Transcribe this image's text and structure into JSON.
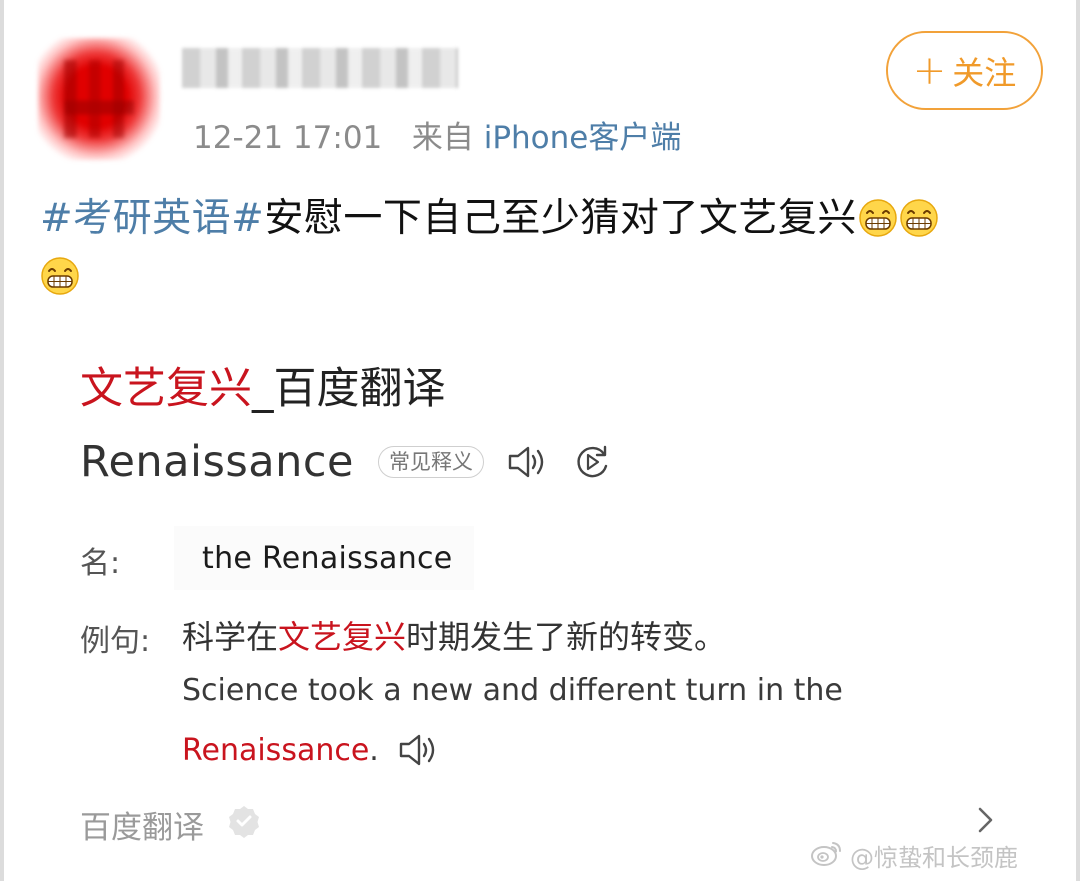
{
  "header": {
    "username": "",
    "timestamp": "12-21 17:01",
    "source_prefix": "来自",
    "source_device": "iPhone客户端",
    "follow_plus": "+",
    "follow_label": "关注"
  },
  "post": {
    "hashtag": "#考研英语#",
    "text": "安慰一下自己至少猜对了文艺复兴",
    "emojis": [
      "grin-emoji",
      "grin-emoji",
      "grin-emoji"
    ]
  },
  "translation_card": {
    "title_highlight": "文艺复兴",
    "title_rest": "_百度翻译",
    "word": "Renaissance",
    "badge": "常见释义",
    "pos_label": "名:",
    "pos_value": "the Renaissance",
    "example_label": "例句:",
    "example_cn_before": "科学在",
    "example_cn_highlight": "文艺复兴",
    "example_cn_after": "时期发生了新的转变。",
    "example_en_line1": "Science took a new and different turn in the",
    "example_en_highlight": "Renaissance",
    "example_en_end": ".",
    "footer_source": "百度翻译"
  },
  "watermark": {
    "text": "@惊蛰和长颈鹿"
  },
  "colors": {
    "link": "#4e7ea8",
    "accent_orange": "#f09a2a",
    "highlight_red": "#c9141e"
  },
  "icons": {
    "speaker": "speaker-icon",
    "replay": "replay-icon",
    "chevron": "chevron-right-icon",
    "verified": "check-badge-icon",
    "weibo": "weibo-logo-icon"
  }
}
